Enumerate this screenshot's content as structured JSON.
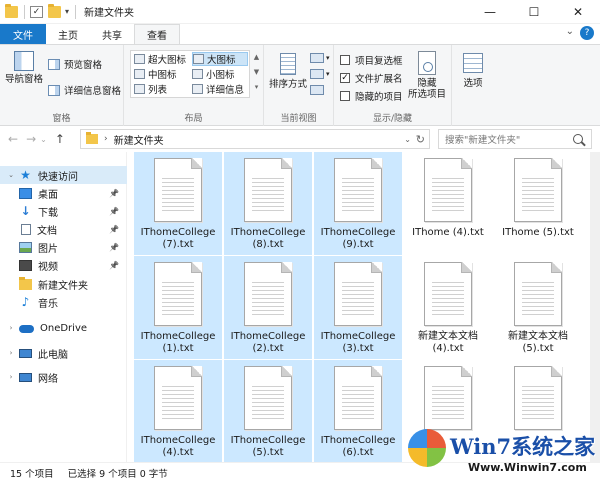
{
  "window": {
    "title": "新建文件夹",
    "minimize": "—",
    "maximize": "☐",
    "close": "✕"
  },
  "tabs": [
    "文件",
    "主页",
    "共享",
    "查看"
  ],
  "ribbon": {
    "pane": {
      "nav_pane": "导航窗格",
      "preview": "预览窗格",
      "details": "详细信息窗格",
      "label": "窗格"
    },
    "layout": {
      "items": [
        "超大图标",
        "大图标",
        "中图标",
        "小图标",
        "列表",
        "详细信息"
      ],
      "selected": "大图标",
      "label": "布局"
    },
    "current_view": {
      "sort": "排序方式",
      "label": "当前视图"
    },
    "show_hide": {
      "item_checkbox": "项目复选框",
      "file_ext": "文件扩展名",
      "hidden_items": "隐藏的项目",
      "hide_selected": "隐藏\n所选项目",
      "label": "显示/隐藏"
    },
    "options": "选项"
  },
  "address": {
    "path": "新建文件夹",
    "search_placeholder": "搜索\"新建文件夹\""
  },
  "nav": [
    {
      "label": "快速访问",
      "icon": "star-icon",
      "pinned": false,
      "selected": true,
      "chevron": true
    },
    {
      "label": "桌面",
      "icon": "desktop-icon",
      "pinned": true
    },
    {
      "label": "下载",
      "icon": "download-icon",
      "pinned": true
    },
    {
      "label": "文档",
      "icon": "document-icon",
      "pinned": true
    },
    {
      "label": "图片",
      "icon": "pictures-icon",
      "pinned": true
    },
    {
      "label": "视频",
      "icon": "video-icon",
      "pinned": true
    },
    {
      "label": "新建文件夹",
      "icon": "folder-icon",
      "pinned": false
    },
    {
      "label": "音乐",
      "icon": "music-icon",
      "pinned": false
    },
    {
      "label": "OneDrive",
      "icon": "onedrive-icon",
      "pinned": false,
      "chevron": true
    },
    {
      "label": "此电脑",
      "icon": "computer-icon",
      "pinned": false,
      "chevron": true
    },
    {
      "label": "网络",
      "icon": "network-icon",
      "pinned": false,
      "chevron": true
    }
  ],
  "files": [
    {
      "name": "IThomeCollege (7).txt",
      "selected": true
    },
    {
      "name": "IThomeCollege (8).txt",
      "selected": true
    },
    {
      "name": "IThomeCollege (9).txt",
      "selected": true
    },
    {
      "name": "IThome (4).txt",
      "selected": false
    },
    {
      "name": "IThome (5).txt",
      "selected": false
    },
    {
      "name": "IThomeCollege (1).txt",
      "selected": true
    },
    {
      "name": "IThomeCollege (2).txt",
      "selected": true
    },
    {
      "name": "IThomeCollege (3).txt",
      "selected": true
    },
    {
      "name": "新建文本文档 (4).txt",
      "selected": false
    },
    {
      "name": "新建文本文档 (5).txt",
      "selected": false
    },
    {
      "name": "IThomeCollege (4).txt",
      "selected": true
    },
    {
      "name": "IThomeCollege (5).txt",
      "selected": true
    },
    {
      "name": "IThomeCollege (6).txt",
      "selected": true
    },
    {
      "name": "",
      "selected": false
    },
    {
      "name": "",
      "selected": false
    }
  ],
  "status": {
    "count": "15 个项目",
    "selection": "已选择 9 个项目  0 字节"
  },
  "watermark": {
    "title": "Win7系统之家",
    "url": "Www.Winwin7.com"
  }
}
